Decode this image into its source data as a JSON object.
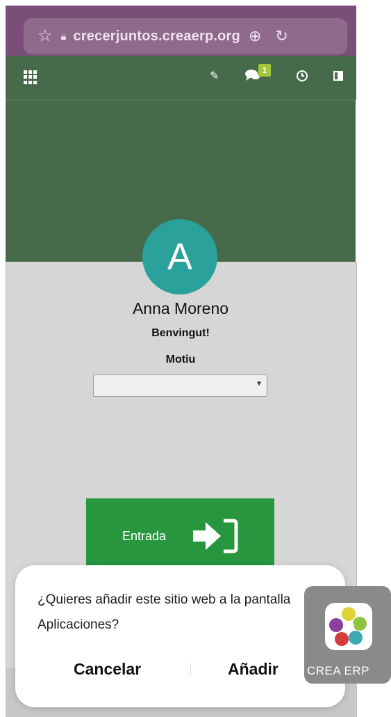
{
  "browser": {
    "url": "crecerjuntos.creaerp.org",
    "star_icon": "star-outline-icon",
    "lock_icon": "lock-icon",
    "download_icon": "download-circle-icon",
    "reload_icon": "reload-icon"
  },
  "toolbar": {
    "apps_icon": "apps-grid-icon",
    "edit_icon": "pencil-icon",
    "messages_icon": "chat-icon",
    "messages_count": "1",
    "activity_icon": "clock-icon",
    "layout_icon": "panel-toggle-icon"
  },
  "profile": {
    "initial": "A",
    "name": "Anna Moreno",
    "greeting": "Benvingut!",
    "reason_label": "Motiu",
    "reason_value": ""
  },
  "entry": {
    "label": "Entrada",
    "icon": "enter-arrow-icon"
  },
  "install_prompt": {
    "message": "¿Quieres añadir este sitio web a la pantalla Aplicaciones?",
    "cancel_label": "Cancelar",
    "add_label": "Añadir",
    "app_name": "CREA ERP"
  },
  "colors": {
    "browser_bar": "#7a4e78",
    "app_green": "#466b4b",
    "avatar": "#2aa19b",
    "entry_button": "#27963f",
    "badge": "#a4c639"
  }
}
